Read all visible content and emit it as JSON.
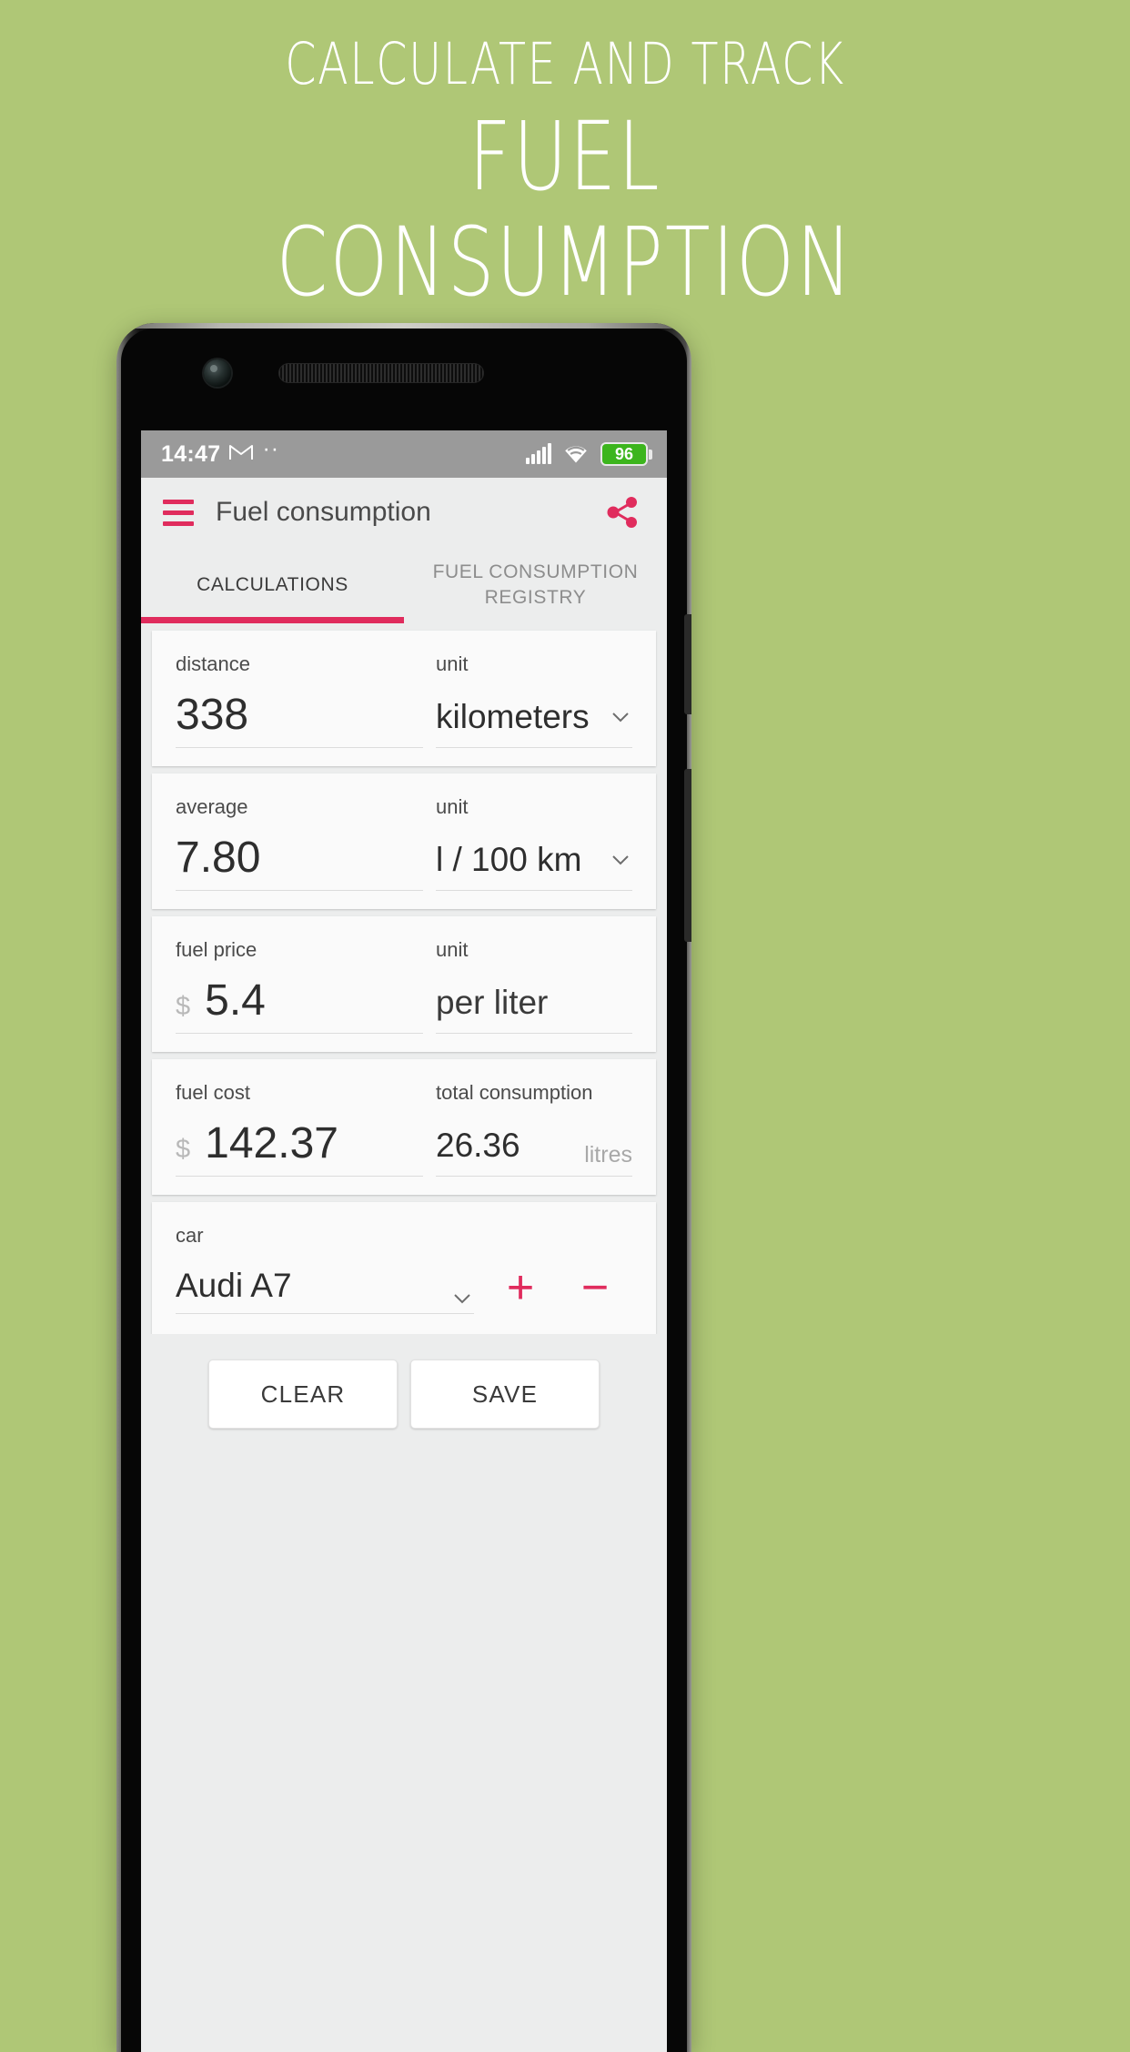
{
  "promo": {
    "line1": "CALCULATE AND TRACK",
    "line2": "FUEL",
    "line3": "CONSUMPTION",
    "background_color": "#afc776",
    "text_color": "#ffffff"
  },
  "accent_color": "#e02c5d",
  "statusbar": {
    "time": "14:47",
    "gmail_icon": "M",
    "dots_icon": "··",
    "battery_level": "96",
    "battery_color": "#3cb51d"
  },
  "appbar": {
    "menu_icon": "hamburger-icon",
    "title": "Fuel consumption",
    "share_icon": "share-icon"
  },
  "tabs": [
    {
      "label": "CALCULATIONS",
      "active": true
    },
    {
      "label": "FUEL CONSUMPTION REGISTRY",
      "active": false
    }
  ],
  "cards": [
    {
      "left": {
        "label": "distance",
        "value": "338",
        "currency": ""
      },
      "right": {
        "label": "unit",
        "value": "kilometers",
        "type": "select"
      }
    },
    {
      "left": {
        "label": "average",
        "value": "7.80",
        "currency": ""
      },
      "right": {
        "label": "unit",
        "value": "l / 100 km",
        "type": "select"
      }
    },
    {
      "left": {
        "label": "fuel price",
        "value": "5.4",
        "currency": "$"
      },
      "right": {
        "label": "unit",
        "value": "per liter",
        "type": "text"
      }
    },
    {
      "left": {
        "label": "fuel cost",
        "value": "142.37",
        "currency": "$"
      },
      "right": {
        "label": "total consumption",
        "value": "26.36",
        "suffix": "litres",
        "type": "readonly"
      }
    }
  ],
  "car": {
    "label": "car",
    "value": "Audi A7",
    "add_label": "+",
    "remove_label": "−"
  },
  "footer": {
    "clear_label": "CLEAR",
    "save_label": "SAVE"
  }
}
